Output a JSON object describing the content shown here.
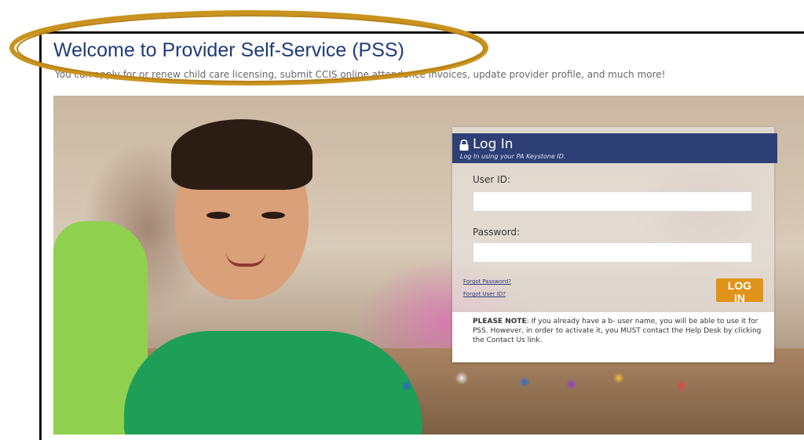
{
  "page": {
    "title": "Welcome to Provider Self-Service (PSS)",
    "subtitle": "You can apply for or renew child care licensing, submit CCIS online attendance invoices, update provider profile, and much more!"
  },
  "login": {
    "title": "Log In",
    "subtitle": "Log In using your PA Keystone ID.",
    "user_id_label": "User ID:",
    "user_id_value": "",
    "password_label": "Password:",
    "password_value": "",
    "forgot_password": "Forgot Password?",
    "forgot_user_id": "Forgot User ID?",
    "button_label": "LOG IN",
    "note_prefix": "PLEASE NOTE",
    "note_body": ": If you already have a b- user name, you will be able to use it for PSS. However, in order to activate it, you MUST contact the Help Desk by clicking the Contact Us link."
  },
  "colors": {
    "title_blue": "#1f3b7a",
    "header_navy": "#2d3f75",
    "button_orange": "#e1941a",
    "highlight_gold": "#c9931e"
  },
  "icons": {
    "lock": "lock-icon"
  }
}
